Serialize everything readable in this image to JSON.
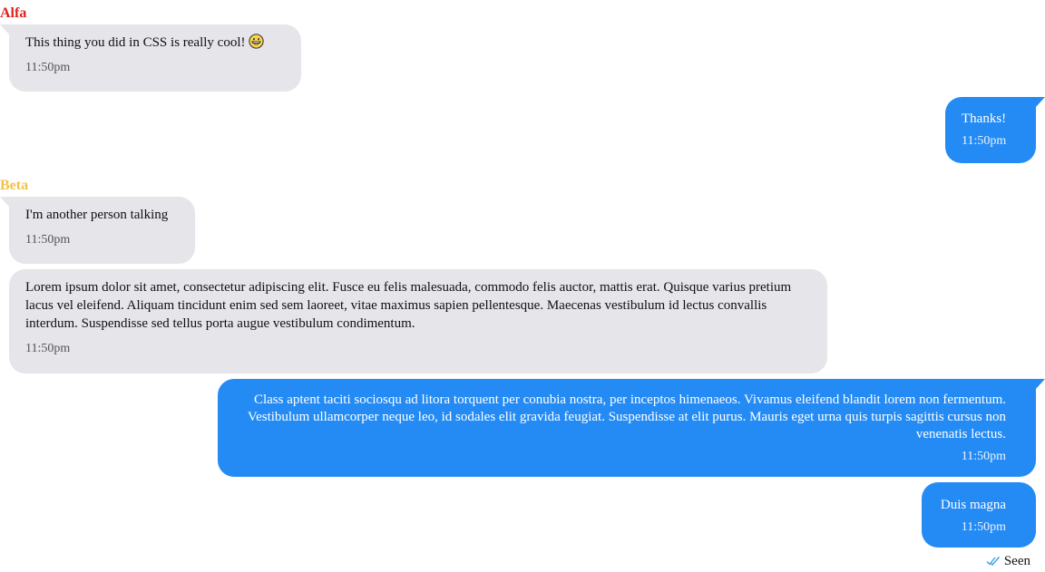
{
  "colors": {
    "incoming_bubble": "#e5e5ea",
    "outgoing_bubble": "#248bf5",
    "sender_alfa": "#e0201c",
    "sender_beta": "#f5c04a",
    "seen_check": "#3aa0e8"
  },
  "messages": [
    {
      "sender": "Alfa",
      "text": "This thing you did in CSS is really cool!",
      "emoji": "grinning-face-icon",
      "time": "11:50pm"
    },
    {
      "text": "Thanks!",
      "time": "11:50pm"
    },
    {
      "sender": "Beta",
      "text": "I'm another person talking",
      "time": "11:50pm"
    },
    {
      "text": "Lorem ipsum dolor sit amet, consectetur adipiscing elit. Fusce eu felis malesuada, commodo felis auctor, mattis erat. Quisque varius pretium lacus vel eleifend. Aliquam tincidunt enim sed sem laoreet, vitae maximus sapien pellentesque. Maecenas vestibulum id lectus convallis interdum. Suspendisse sed tellus porta augue vestibulum condimentum.",
      "time": "11:50pm"
    },
    {
      "text": "Class aptent taciti sociosqu ad litora torquent per conubia nostra, per inceptos himenaeos. Vivamus eleifend blandit lorem non fermentum. Vestibulum ullamcorper neque leo, id sodales elit gravida feugiat. Suspendisse at elit purus. Mauris eget urna quis turpis sagittis cursus non venenatis lectus.",
      "time": "11:50pm"
    },
    {
      "text": "Duis magna",
      "time": "11:50pm"
    }
  ],
  "status": {
    "icon": "double-check-icon",
    "label": "Seen"
  }
}
